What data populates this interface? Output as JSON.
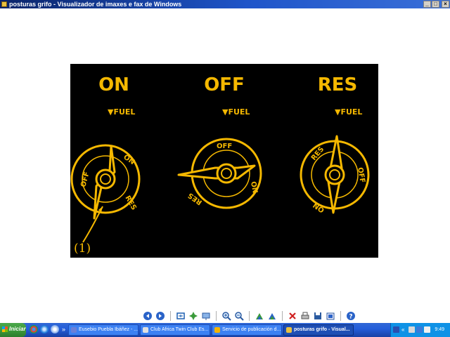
{
  "window": {
    "title": "posturas grifo - Visualizador de imaxes e fax de Windows",
    "minimize": "_",
    "maximize": "□",
    "close": "×"
  },
  "image": {
    "labels": {
      "on": "ON",
      "off": "OFF",
      "res": "RES",
      "fuel": "▼FUEL",
      "callout": "(1)"
    },
    "dial_text": {
      "on": "ON",
      "off": "OFF",
      "res": "RES"
    },
    "colors": {
      "background": "#000000",
      "ink": "#f5b800"
    }
  },
  "toolbar": {
    "buttons": [
      "previous-image",
      "next-image",
      "best-fit",
      "actual-size",
      "slide-show",
      "zoom-in",
      "zoom-out",
      "rotate-clockwise",
      "rotate-counterclockwise",
      "delete",
      "print",
      "save",
      "open",
      "help"
    ]
  },
  "taskbar": {
    "start_label": "Iniciar",
    "tasks": [
      {
        "label": "Eusebio Puebla Ibáñez - ...",
        "active": false
      },
      {
        "label": "Club Africa Twin Club Es...",
        "active": false
      },
      {
        "label": "Servicio de publicación d...",
        "active": false
      },
      {
        "label": "posturas grifo - Visual...",
        "active": true
      }
    ],
    "overflow": "»",
    "tray_overflow": "«",
    "clock": "9:49"
  }
}
